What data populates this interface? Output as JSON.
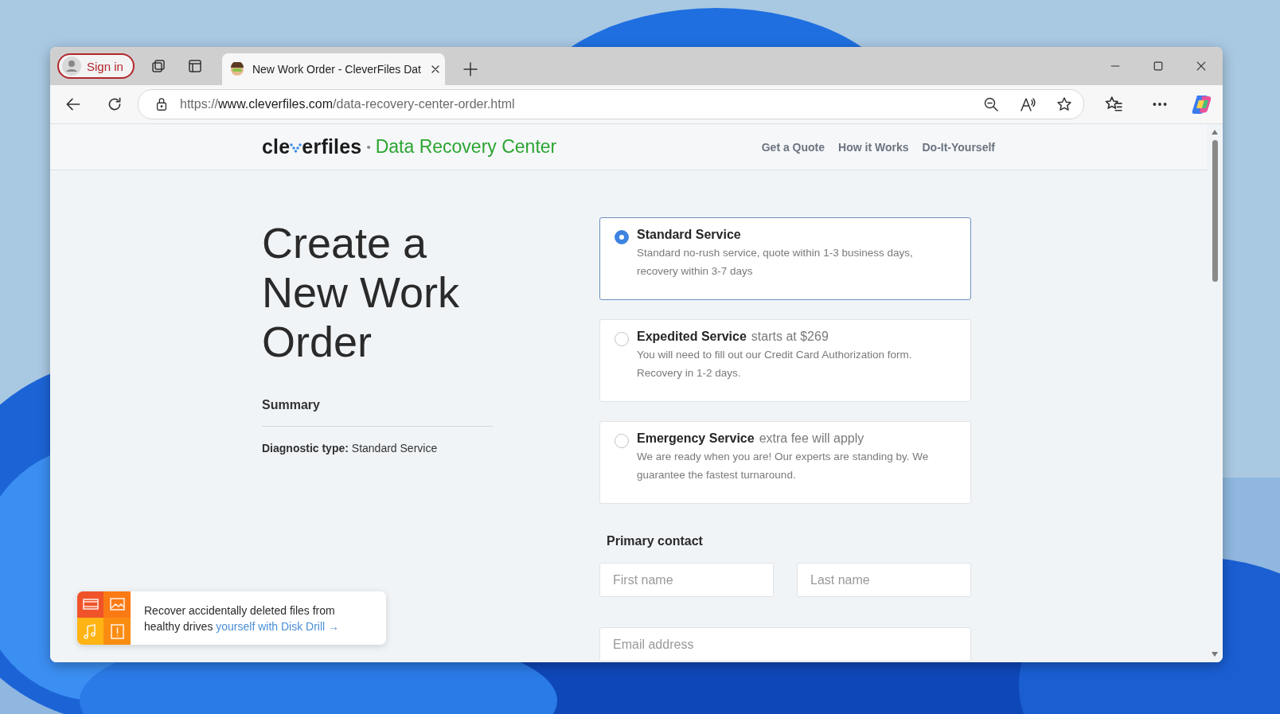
{
  "browser": {
    "sign_in": "Sign in",
    "tab": {
      "title": "New Work Order - CleverFiles Dat",
      "selected": true
    },
    "address": "https://**www.cleverfiles.com**/data-recovery-center-order.html"
  },
  "site_header": {
    "logo": {
      "before": "cle",
      "after": "erfiles"
    },
    "separator": "•",
    "product": "Data Recovery Center",
    "nav": [
      "Get a Quote",
      "How it Works",
      "Do-It-Yourself"
    ]
  },
  "heading": "Create a New Work Order",
  "summary": {
    "title": "Summary",
    "line": "**Diagnostic type:** Standard Service"
  },
  "services": [
    {
      "title": "Standard Service",
      "description": "Standard no-rush service, quote within 1-3 business days, recovery within 3-7 days",
      "selected": true
    },
    {
      "title": "Expedited Service",
      "note": "starts at $269",
      "description": "You will need to fill out our Credit Card Authorization form. Recovery in 1-2 days.",
      "selected": false
    },
    {
      "title": "Emergency Service",
      "note": "extra fee will apply",
      "description": "We are ready when you are! Our experts are standing by. We guarantee the fastest turnaround.",
      "selected": false
    }
  ],
  "primary_contact": {
    "title": "Primary contact",
    "fields": [
      {
        "placeholder": "First name"
      },
      {
        "placeholder": "Last name"
      },
      {
        "placeholder": "Email address"
      }
    ]
  },
  "promo": {
    "text": "Recover accidentally deleted files from healthy drives ",
    "link": "yourself with Disk Drill →"
  }
}
